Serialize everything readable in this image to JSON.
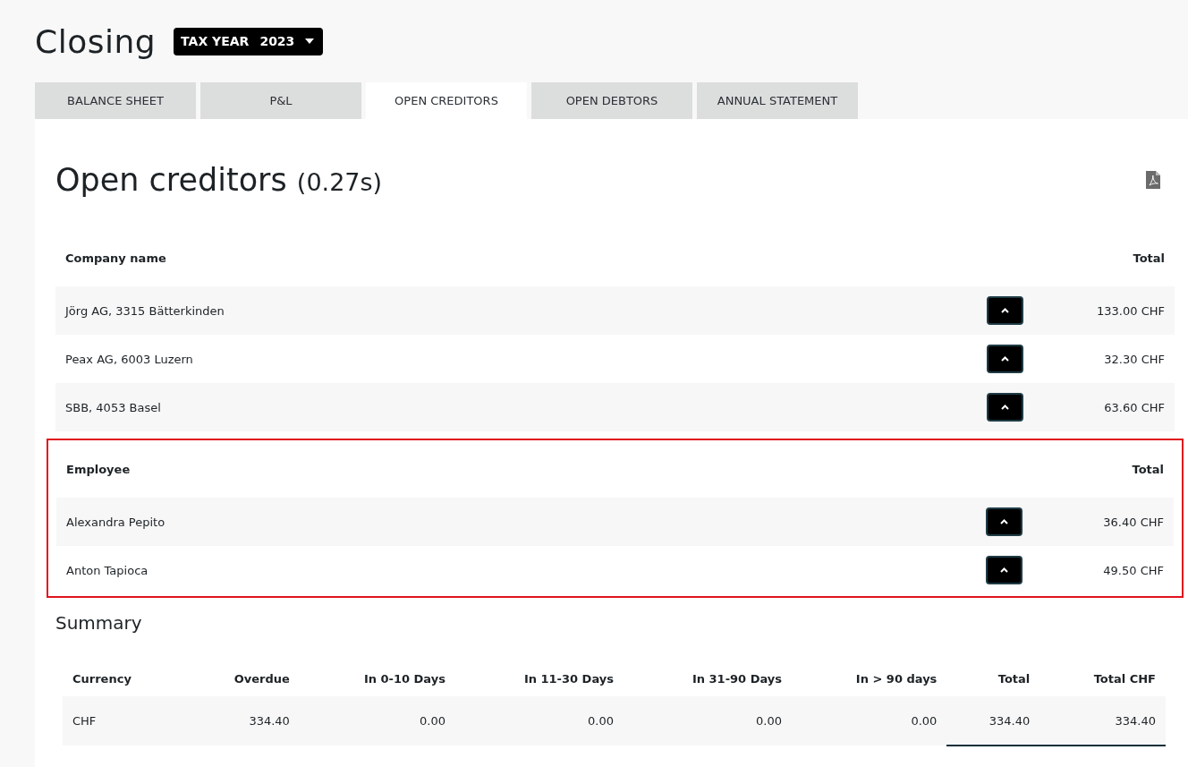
{
  "page_title": "Closing",
  "tax_year": {
    "label": "TAX YEAR",
    "value": "2023"
  },
  "tabs": [
    {
      "label": "BALANCE SHEET",
      "selected": false
    },
    {
      "label": "P&L",
      "selected": false
    },
    {
      "label": "OPEN CREDITORS",
      "selected": true
    },
    {
      "label": "OPEN DEBTORS",
      "selected": false
    },
    {
      "label": "ANNUAL STATEMENT",
      "selected": false
    }
  ],
  "report": {
    "title": "Open creditors",
    "timing": "(0.27s)"
  },
  "groups": [
    {
      "columns": [
        "Company name",
        "Total"
      ],
      "highlighted": false,
      "rows": [
        {
          "name": "Jörg AG, 3315 Bätterkinden",
          "total": "133.00 CHF"
        },
        {
          "name": "Peax AG, 6003 Luzern",
          "total": "32.30 CHF"
        },
        {
          "name": "SBB, 4053 Basel",
          "total": "63.60 CHF"
        }
      ]
    },
    {
      "columns": [
        "Employee",
        "Total"
      ],
      "highlighted": true,
      "rows": [
        {
          "name": "Alexandra Pepito",
          "total": "36.40 CHF"
        },
        {
          "name": "Anton Tapioca",
          "total": "49.50 CHF"
        }
      ]
    }
  ],
  "summary": {
    "title": "Summary",
    "columns": [
      "Currency",
      "Overdue",
      "In 0-10 Days",
      "In 11-30 Days",
      "In 31-90 Days",
      "In > 90 days",
      "Total",
      "Total CHF"
    ],
    "rows": [
      [
        "CHF",
        "334.40",
        "0.00",
        "0.00",
        "0.00",
        "0.00",
        "334.40",
        "334.40"
      ]
    ]
  }
}
